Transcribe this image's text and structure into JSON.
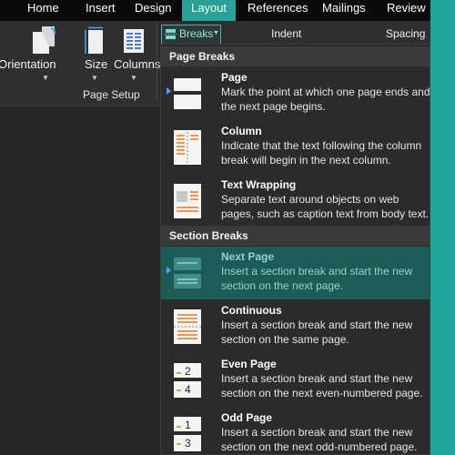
{
  "tabs": [
    "Home",
    "Insert",
    "Design",
    "Layout",
    "References",
    "Mailings",
    "Review"
  ],
  "ribbon": {
    "orientation_label": "Orientation",
    "size_label": "Size",
    "columns_label": "Columns",
    "group_label": "Page Setup",
    "breaks_label": "Breaks",
    "indent_label": "Indent",
    "spacing_label": "Spacing"
  },
  "menu": {
    "page_breaks_header": "Page Breaks",
    "section_breaks_header": "Section Breaks",
    "items": [
      {
        "title": "Page",
        "desc": "Mark the point at which one page ends and the next page begins.",
        "icon": "page-break-icon"
      },
      {
        "title": "Column",
        "desc": "Indicate that the text following the column break will begin in the next column.",
        "icon": "column-break-icon"
      },
      {
        "title": "Text Wrapping",
        "desc": "Separate text around objects on web pages, such as caption text from body text.",
        "icon": "text-wrapping-break-icon"
      },
      {
        "title": "Next Page",
        "desc": "Insert a section break and start the new section on the next page.",
        "icon": "next-page-break-icon"
      },
      {
        "title": "Continuous",
        "desc": "Insert a section break and start the new section on the same page.",
        "icon": "continuous-break-icon"
      },
      {
        "title": "Even Page",
        "desc": "Insert a section break and start the new section on the next even-numbered page.",
        "icon": "even-page-break-icon",
        "numbers": [
          "2",
          "4"
        ]
      },
      {
        "title": "Odd Page",
        "desc": "Insert a section break and start the new section on the next odd-numbered page.",
        "icon": "odd-page-break-icon",
        "numbers": [
          "1",
          "3"
        ]
      }
    ]
  },
  "colors": {
    "accent": "#2aa096",
    "highlight": "#1b5c56",
    "background": "#1fa599",
    "orange": "#e07b24"
  }
}
